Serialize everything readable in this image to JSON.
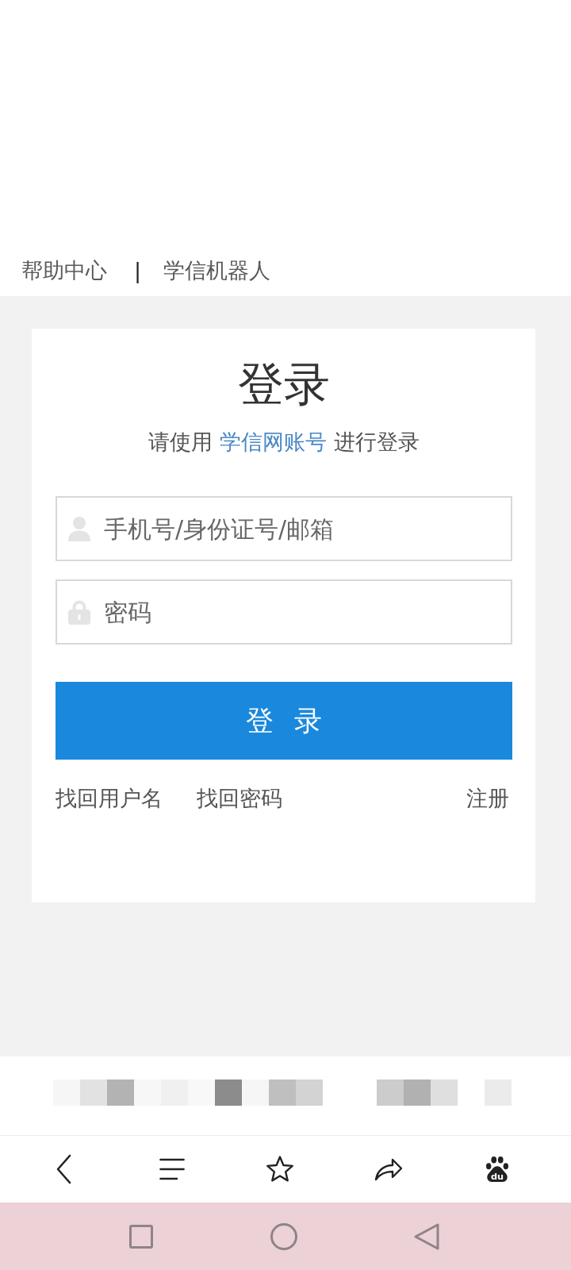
{
  "top_links": [
    {
      "label": "帮助中心"
    },
    {
      "label": "学信机器人"
    }
  ],
  "top_links_separator": "|",
  "login_card": {
    "title": "登录",
    "hint": {
      "before": "请使用 ",
      "link": "学信网账号",
      "after": " 进行登录"
    },
    "fields": [
      {
        "kind": "account",
        "placeholder": "手机号/身份证号/邮箱"
      },
      {
        "kind": "password",
        "placeholder": "密码"
      }
    ],
    "submit_button": "登 录",
    "links": [
      {
        "label": "找回用户名"
      },
      {
        "label": "找回密码"
      },
      {
        "label": "注册"
      }
    ]
  },
  "browser_toolbar": {
    "logo_text": "du"
  }
}
